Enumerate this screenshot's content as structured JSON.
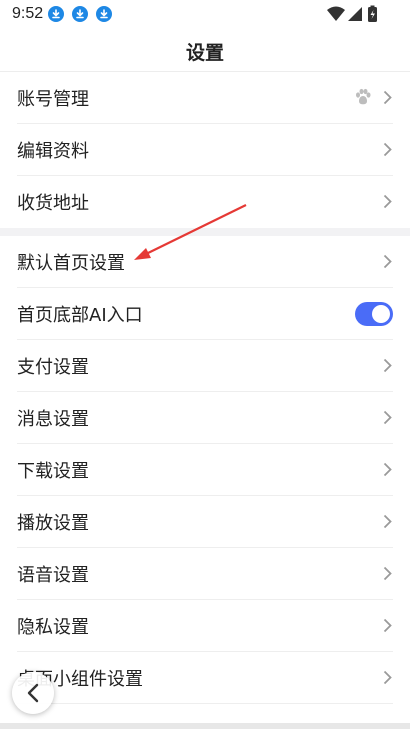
{
  "status_bar": {
    "time": "9:52"
  },
  "header": {
    "title": "设置"
  },
  "settings": {
    "account": "账号管理",
    "profile": "编辑资料",
    "address": "收货地址",
    "default_home": "默认首页设置",
    "ai_entry": "首页底部AI入口",
    "payment": "支付设置",
    "message": "消息设置",
    "download": "下载设置",
    "playback": "播放设置",
    "voice": "语音设置",
    "privacy": "隐私设置",
    "widget": "桌面小组件设置"
  },
  "toggles": {
    "ai_entry_on": true
  },
  "colors": {
    "accent": "#4a6cf7",
    "annotation_arrow": "#e53935",
    "download_badge": "#1e88e5"
  },
  "icons": {
    "download": "download-icon",
    "wifi": "wifi-icon",
    "signal": "signal-icon",
    "battery": "battery-icon",
    "chevron": "chevron-right-icon",
    "account_badge": "paw-icon",
    "back": "back-arrow-icon"
  }
}
